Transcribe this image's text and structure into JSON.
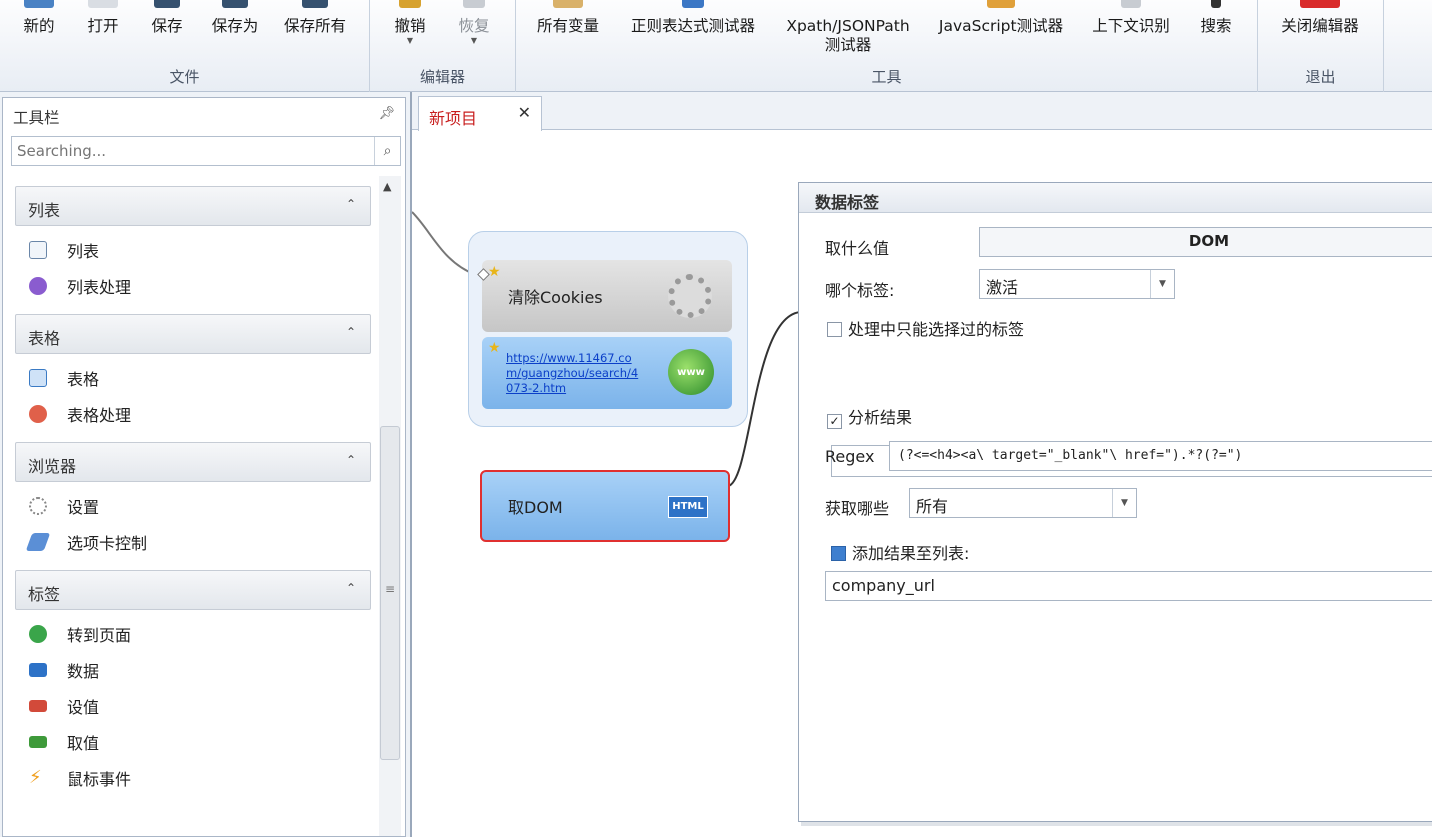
{
  "ribbon": {
    "groups": [
      {
        "title": "文件",
        "buttons": [
          "新的",
          "打开",
          "保存",
          "保存为",
          "保存所有"
        ]
      },
      {
        "title": "编辑器",
        "buttons": [
          "撤销",
          "恢复"
        ]
      },
      {
        "title": "工具",
        "buttons": [
          "所有变量",
          "正则表达式测试器",
          "Xpath/JSONPath",
          "测试器",
          "JavaScript测试器",
          "上下文识别",
          "搜索"
        ]
      },
      {
        "title": "退出",
        "buttons": [
          "关闭编辑器"
        ]
      }
    ]
  },
  "toolbox": {
    "title": "工具栏",
    "pin_icon": "pin-icon",
    "search_placeholder": "Searching...",
    "categories": [
      {
        "name": "列表",
        "items": [
          "列表",
          "列表处理"
        ]
      },
      {
        "name": "表格",
        "items": [
          "表格",
          "表格处理"
        ]
      },
      {
        "name": "浏览器",
        "items": [
          "设置",
          "选项卡控制"
        ]
      },
      {
        "name": "标签",
        "items": [
          "转到页面",
          "数据",
          "设值",
          "取值",
          "鼠标事件"
        ]
      }
    ]
  },
  "tabs": [
    {
      "label": "新项目",
      "close": "✕"
    }
  ],
  "flow": {
    "nodes": {
      "clear_cookies": "清除Cookies",
      "url": "https://www.11467.com/guangzhou/search/4073-2.htm",
      "url_line1": "https://www.11467.co",
      "url_line2": "m/guangzhou/search/4",
      "url_line3": "073-2.htm",
      "get_dom": "取DOM",
      "www_badge": "www",
      "html_badge": "HTML"
    }
  },
  "props": {
    "title": "数据标签",
    "value_label": "取什么值",
    "value": "DOM",
    "tag_label": "哪个标签:",
    "tag_value": "激活",
    "only_selected_label": "处理中只能选择过的标签",
    "only_selected_checked": false,
    "parse_label": "分析结果",
    "parse_checked": true,
    "regex_label": "Regex",
    "regex_value": "(?<=<h4><a\\ target=\"_blank\"\\ href=\").*?(?=\")",
    "fetch_label": "获取哪些",
    "fetch_value": "所有",
    "add_to_list_label": "添加结果至列表:",
    "list_value": "company_url"
  }
}
